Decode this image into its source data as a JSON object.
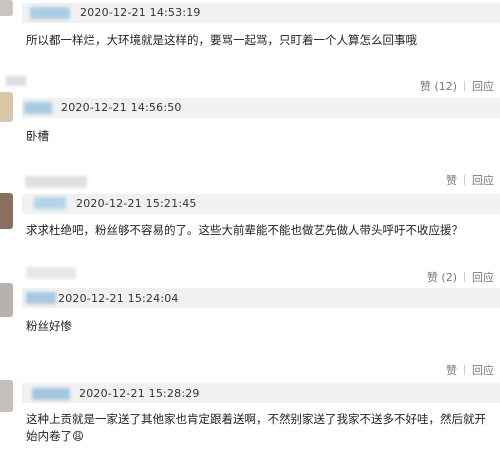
{
  "comments": [
    {
      "time": "2020-12-21 14:53:19",
      "text": "所以都一样烂，大环境就是这样的，要骂一起骂，只盯着一个人算怎么回事哦",
      "like": "赞 (12)",
      "reply": "回应"
    },
    {
      "time": "2020-12-21 14:56:50",
      "text": "卧槽",
      "like": "赞",
      "reply": "回应"
    },
    {
      "time": "2020-12-21 15:21:45",
      "text": "求求杜绝吧，粉丝够不容易的了。这些大前辈能不能也做艺先做人带头呼吁不收应援？",
      "like": "赞 (2)",
      "reply": "回应"
    },
    {
      "time": "2020-12-21 15:24:04",
      "text": "粉丝好惨",
      "like": "赞",
      "reply": "回应"
    },
    {
      "time": "2020-12-21 15:28:29",
      "text": "这种上贡就是一家送了其他家也肯定跟着送啊，不然别家送了我家不送多不好哇，然后就开始内卷了😩",
      "like": "",
      "reply": ""
    }
  ]
}
